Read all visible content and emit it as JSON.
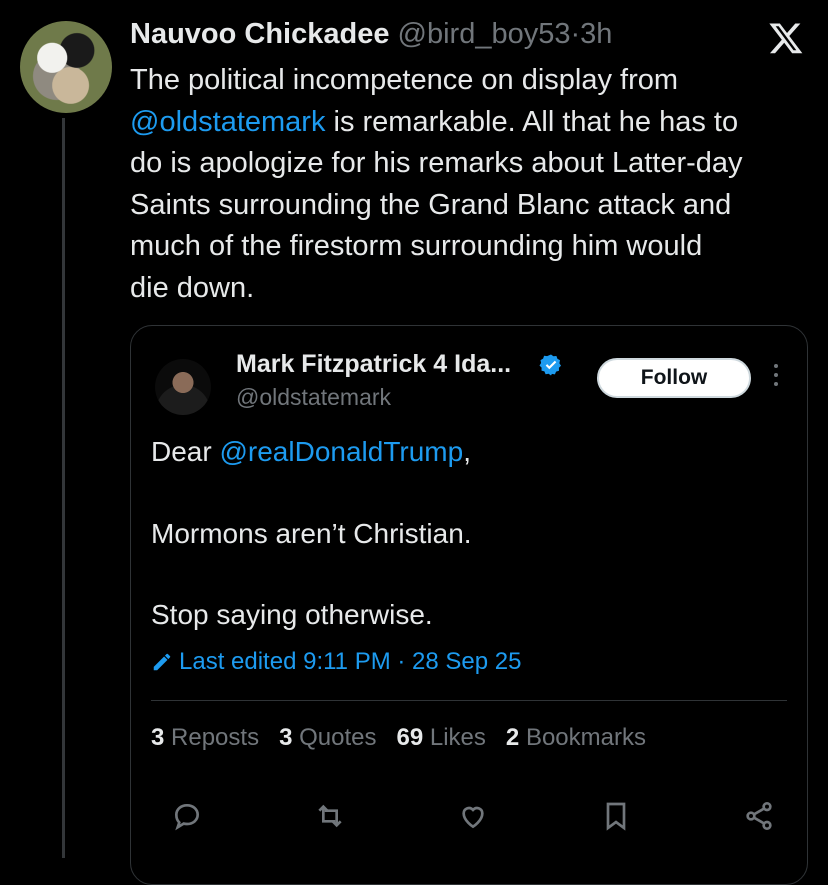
{
  "post": {
    "author_name": "Nauvoo Chickadee",
    "author_handle": "@bird_boy53",
    "dot": "·",
    "time": "3h",
    "text_lines": [
      "The political incompetence on display from",
      "is remarkable. All that he has to",
      "do is apologize for his remarks about Latter-day",
      "Saints surrounding the Grand Blanc attack and",
      "much of the firestorm surrounding him would",
      "die down."
    ],
    "mention": "@oldstatemark"
  },
  "quote": {
    "author_name": "Mark Fitzpatrick 4 Ida...",
    "author_handle": "@oldstatemark",
    "follow_label": "Follow",
    "greeting": "Dear",
    "greeting_mention": "@realDonaldTrump",
    "greeting_suffix": ",",
    "line2": "Mormons aren’t Christian.",
    "line3": "Stop saying otherwise.",
    "edited": "Last edited 9:11 PM · 28 Sep 25",
    "stats": {
      "reposts_count": "3",
      "reposts_label": "Reposts",
      "quotes_count": "3",
      "quotes_label": "Quotes",
      "likes_count": "69",
      "likes_label": "Likes",
      "bookmarks_count": "2",
      "bookmarks_label": "Bookmarks"
    },
    "actions": [
      "reply-icon",
      "repost-icon",
      "like-icon",
      "bookmark-icon",
      "share-icon"
    ]
  },
  "colors": {
    "background": "#000000",
    "text": "#e7e9ea",
    "muted": "#71767b",
    "link": "#1d9bf0",
    "border": "#2f3336"
  }
}
